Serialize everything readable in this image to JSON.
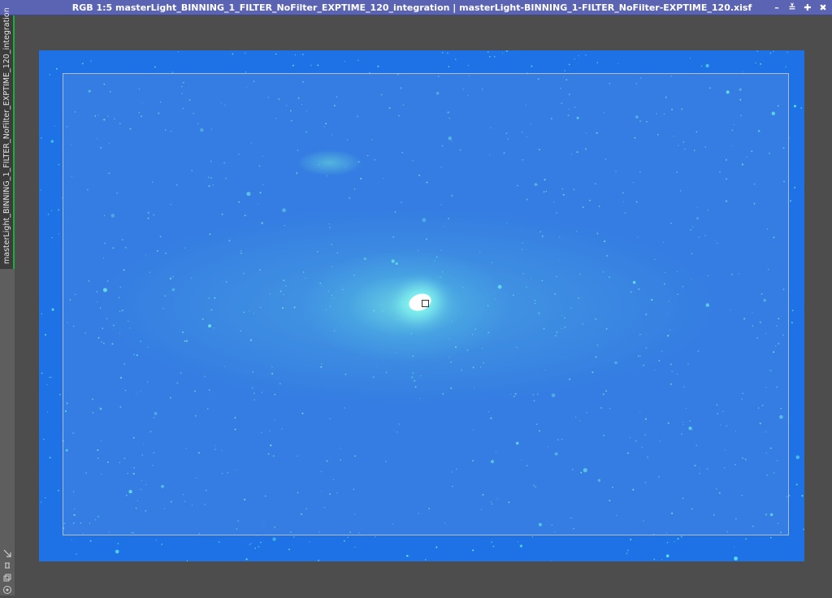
{
  "window": {
    "title": "RGB 1:5 masterLight_BINNING_1_FILTER_NoFilter_EXPTIME_120_integration | masterLight-BINNING_1-FILTER_NoFilter-EXPTIME_120.xisf",
    "controls": [
      "minimize-icon",
      "shade-icon",
      "maximize-icon",
      "close-icon"
    ],
    "control_glyphs": {
      "minimize": "–",
      "shade": "≚",
      "maximize": "✚",
      "close": "✖"
    }
  },
  "view_tab": {
    "label": "masterLight_BINNING_1_FILTER_NoFilter_EXPTIME_120_integration"
  },
  "strip_icons": [
    "arrow-icon",
    "link-icon",
    "copy-icon",
    "target-icon"
  ],
  "colors": {
    "titlebar": "#5b63b3",
    "background": "#4d4d4d",
    "image_blue": "#1f72e6",
    "tab_accent": "#1fae3e",
    "star": "#5ff0e6"
  }
}
